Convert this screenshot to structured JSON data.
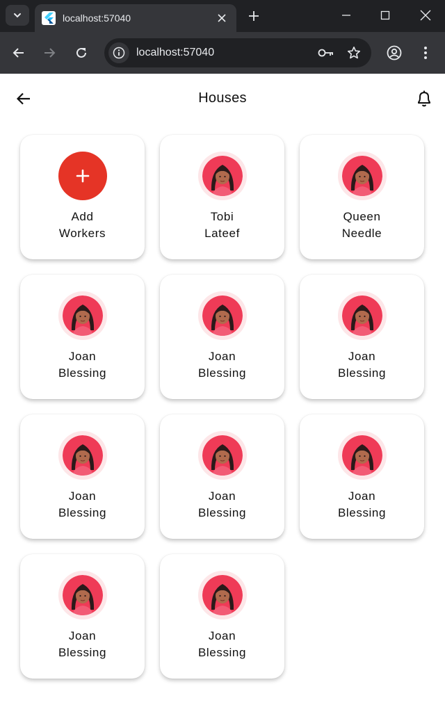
{
  "browser": {
    "tab_title": "localhost:57040",
    "url": "localhost:57040"
  },
  "app": {
    "title": "Houses",
    "add_card": {
      "line1": "Add",
      "line2": "Workers"
    },
    "workers": [
      {
        "first": "Tobi",
        "last": "Lateef"
      },
      {
        "first": "Queen",
        "last": "Needle"
      },
      {
        "first": "Joan",
        "last": "Blessing"
      },
      {
        "first": "Joan",
        "last": "Blessing"
      },
      {
        "first": "Joan",
        "last": "Blessing"
      },
      {
        "first": "Joan",
        "last": "Blessing"
      },
      {
        "first": "Joan",
        "last": "Blessing"
      },
      {
        "first": "Joan",
        "last": "Blessing"
      },
      {
        "first": "Joan",
        "last": "Blessing"
      },
      {
        "first": "Joan",
        "last": "Blessing"
      }
    ]
  },
  "colors": {
    "accent": "#e53426",
    "avatar_bg": "#ef3b57",
    "avatar_ring": "#fde6e8"
  },
  "icons": {
    "back": "arrow-left-icon",
    "notification": "bell-icon",
    "add": "plus-icon",
    "avatar": "woman-avatar-icon"
  }
}
